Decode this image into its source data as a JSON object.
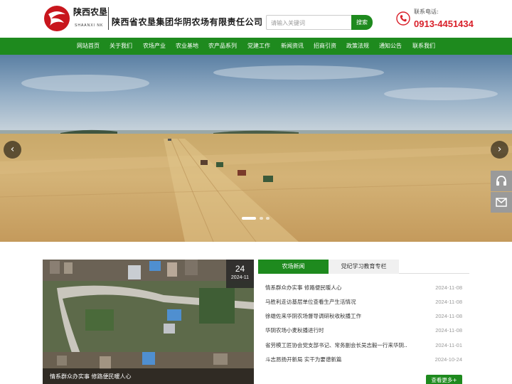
{
  "header": {
    "brand_cn": "陕西农垦",
    "brand_en": "SHAANXI NK",
    "company": "陕西省农垦集团华阴农场有限责任公司",
    "search_placeholder": "请输入关键词",
    "search_button": "搜索",
    "phone_label": "联系电话:",
    "phone_number": "0913-4451434"
  },
  "nav": {
    "items": [
      "网站首页",
      "关于我们",
      "农场产业",
      "农业基地",
      "农产品系列",
      "党建工作",
      "新闻资讯",
      "招商引资",
      "政策法规",
      "通知公告",
      "联系我们"
    ]
  },
  "banner": {
    "prev_label": "‹",
    "next_label": "›",
    "slide_count": 3,
    "active_slide": 1
  },
  "featured": {
    "day": "24",
    "year_month": "2024-11",
    "caption": "情系群众办实事 修路便民暖人心"
  },
  "tabs": [
    "农场新闻",
    "党纪学习教育专栏"
  ],
  "news": [
    {
      "title": "情系群众办实事 修路便民暖人心",
      "date": "2024-11-08"
    },
    {
      "title": "马胜利走访基层单位查看生产生活情况",
      "date": "2024-11-08"
    },
    {
      "title": "徐雄佐来华阴农场督导调研秋收秋播工作",
      "date": "2024-11-08"
    },
    {
      "title": "华阴农场小麦秋播进行时",
      "date": "2024-11-08"
    },
    {
      "title": "省劳模工匠协会党支部书记、常务副会长吴志毅一行来华阴...",
      "date": "2024-11-01"
    },
    {
      "title": "斗志昂扬开新局 实干为要谱新篇",
      "date": "2024-10-24"
    }
  ],
  "more_button": "查看更多+",
  "colors": {
    "primary_green": "#1e8a1e",
    "phone_red": "#d9202a"
  }
}
